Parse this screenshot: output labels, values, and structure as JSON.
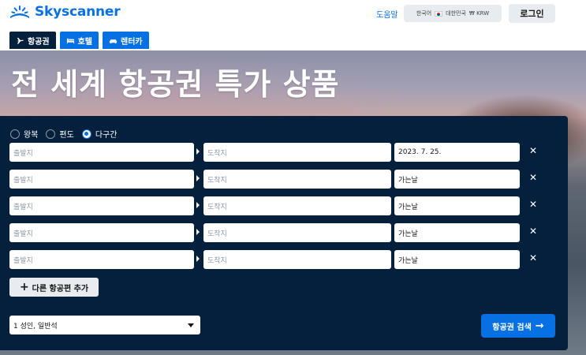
{
  "header": {
    "logo_text": "Skyscanner",
    "help_label": "도움말",
    "locale": {
      "language": "한국어",
      "region": "대한민국",
      "currency": "₩ KRW"
    },
    "login_label": "로그인"
  },
  "tabs": [
    {
      "label": "항공권",
      "icon": "plane-icon",
      "active": true
    },
    {
      "label": "호텔",
      "icon": "bed-icon",
      "active": false
    },
    {
      "label": "렌터카",
      "icon": "car-icon",
      "active": false
    }
  ],
  "hero": {
    "title": "전 세계 항공권 특가 상품"
  },
  "search": {
    "trip_types": [
      {
        "label": "왕복",
        "checked": false
      },
      {
        "label": "편도",
        "checked": false
      },
      {
        "label": "다구간",
        "checked": true
      }
    ],
    "legs": [
      {
        "origin_placeholder": "출발지",
        "dest_placeholder": "도착지",
        "date": "2023. 7. 25."
      },
      {
        "origin_placeholder": "출발지",
        "dest_placeholder": "도착지",
        "date": "가는날"
      },
      {
        "origin_placeholder": "출발지",
        "dest_placeholder": "도착지",
        "date": "가는날"
      },
      {
        "origin_placeholder": "출발지",
        "dest_placeholder": "도착지",
        "date": "가는날"
      },
      {
        "origin_placeholder": "출발지",
        "dest_placeholder": "도착지",
        "date": "가는날"
      }
    ],
    "remove_symbol": "✕",
    "add_flight_label": "다른 항공편 추가",
    "travellers": "1 성인, 일반석",
    "search_button": "항공권 검색"
  },
  "colors": {
    "brand": "#0770e3",
    "panel": "#05203c"
  }
}
